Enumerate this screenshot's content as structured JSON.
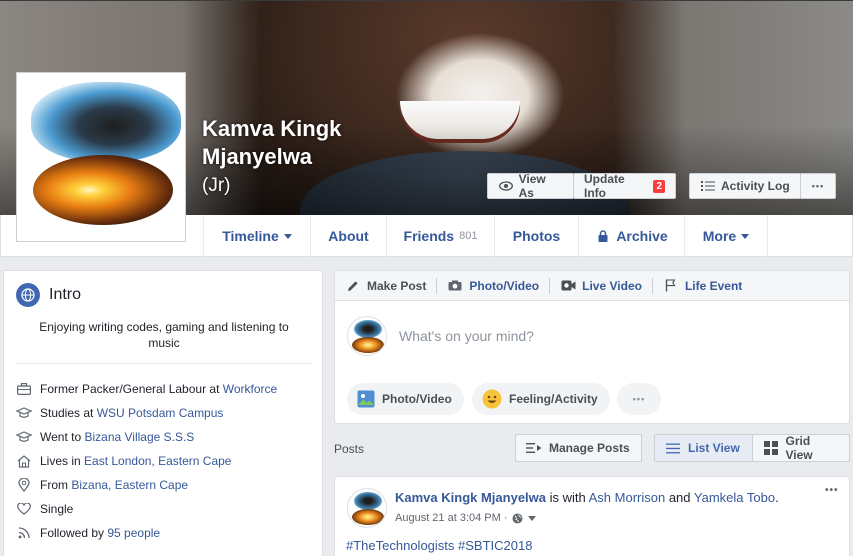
{
  "profile": {
    "name": "Kamva Kingk Mjanyelwa",
    "alternate_name": "(Jr)"
  },
  "cover_actions": {
    "view_as": "View As",
    "update_info": "Update Info",
    "update_info_badge": "2",
    "activity_log": "Activity Log",
    "more": "•••"
  },
  "nav": {
    "timeline": "Timeline",
    "about": "About",
    "friends": "Friends",
    "friends_count": "801",
    "photos": "Photos",
    "archive": "Archive",
    "more": "More"
  },
  "intro": {
    "title": "Intro",
    "bio": "Enjoying writing codes, gaming and listening to music",
    "items": [
      {
        "icon": "briefcase-icon",
        "text": "Former Packer/General Labour at ",
        "link": "Workforce"
      },
      {
        "icon": "graduation-cap-icon",
        "text": "Studies at ",
        "link": "WSU Potsdam Campus"
      },
      {
        "icon": "graduation-cap-icon",
        "text": "Went to ",
        "link": "Bizana Village S.S.S"
      },
      {
        "icon": "home-icon",
        "text": "Lives in ",
        "link": "East London, Eastern Cape"
      },
      {
        "icon": "map-pin-icon",
        "text": "From ",
        "link": "Bizana, Eastern Cape"
      },
      {
        "icon": "heart-icon",
        "text": "Single",
        "link": ""
      },
      {
        "icon": "rss-icon",
        "text": "Followed by ",
        "link": "95 people"
      }
    ]
  },
  "composer": {
    "tabs": {
      "make_post": "Make Post",
      "photo_video": "Photo/Video",
      "live_video": "Live Video",
      "life_event": "Life Event"
    },
    "placeholder": "What's on your mind?",
    "pills": {
      "photo_video": "Photo/Video",
      "feeling": "Feeling/Activity",
      "more": "•••"
    }
  },
  "posts_header": {
    "label": "Posts",
    "manage": "Manage Posts",
    "list_view": "List View",
    "grid_view": "Grid View"
  },
  "post": {
    "author": "Kamva Kingk Mjanyelwa",
    "with_text": " is with ",
    "friend1": "Ash Morrison",
    "and_text": " and ",
    "friend2": "Yamkela Tobo",
    "period": ".",
    "time": "August 21 at 3:04 PM ·",
    "text": "#TheTechnologists #SBTIC2018",
    "more": "•••"
  },
  "colors": {
    "link": "#365899",
    "brand": "#4267b2",
    "badge": "#fa3e3e",
    "page_bg": "#e9ebee"
  }
}
